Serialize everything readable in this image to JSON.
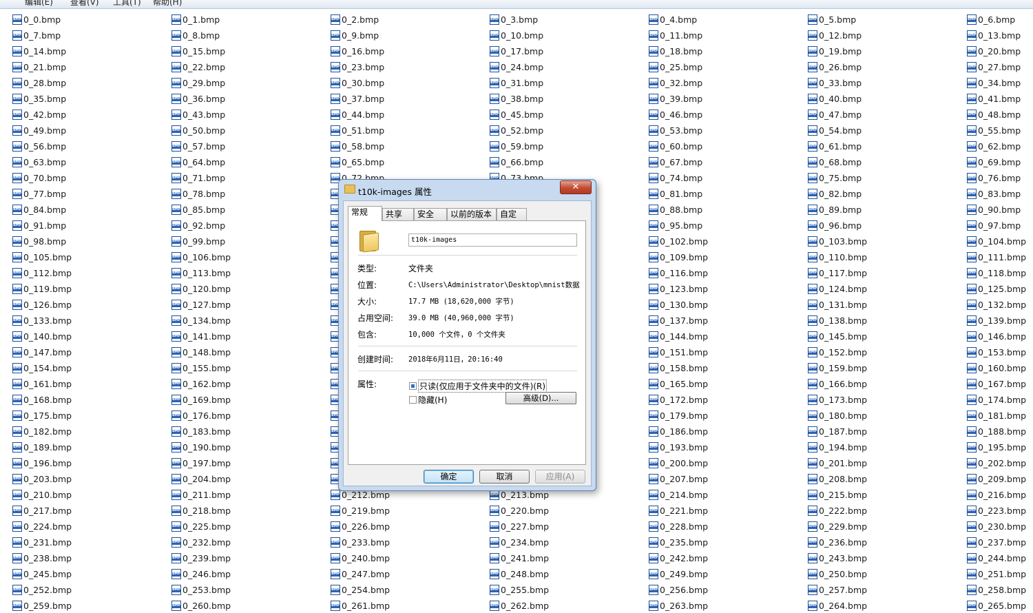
{
  "menubar": {
    "items": [
      "编辑(E)",
      "查看(V)",
      "工具(T)",
      "帮助(H)"
    ]
  },
  "grid": {
    "columns": 7,
    "first_index": 0,
    "count": 266,
    "prefix": "0_",
    "suffix": ".bmp"
  },
  "dialog": {
    "title": "t10k-images 属性",
    "close_label": "✕",
    "tabs": [
      "常规",
      "共享",
      "安全",
      "以前的版本",
      "自定义"
    ],
    "name": "t10k-images",
    "type_label": "类型:",
    "type_value": "文件夹",
    "location_label": "位置:",
    "location_value": "C:\\Users\\Administrator\\Desktop\\mnist数据集",
    "size_label": "大小:",
    "size_value": "17.7 MB (18,620,000 字节)",
    "disk_label": "占用空间:",
    "disk_value": "39.0 MB (40,960,000 字节)",
    "contains_label": "包含:",
    "contains_value": "10,000 个文件，0 个文件夹",
    "created_label": "创建时间:",
    "created_value": "2018年6月11日，20:16:40",
    "attrs_label": "属性:",
    "readonly_label": "只读(仅应用于文件夹中的文件)(R)",
    "hidden_label": "隐藏(H)",
    "advanced_label": "高级(D)...",
    "ok_label": "确定",
    "cancel_label": "取消",
    "apply_label": "应用(A)"
  }
}
